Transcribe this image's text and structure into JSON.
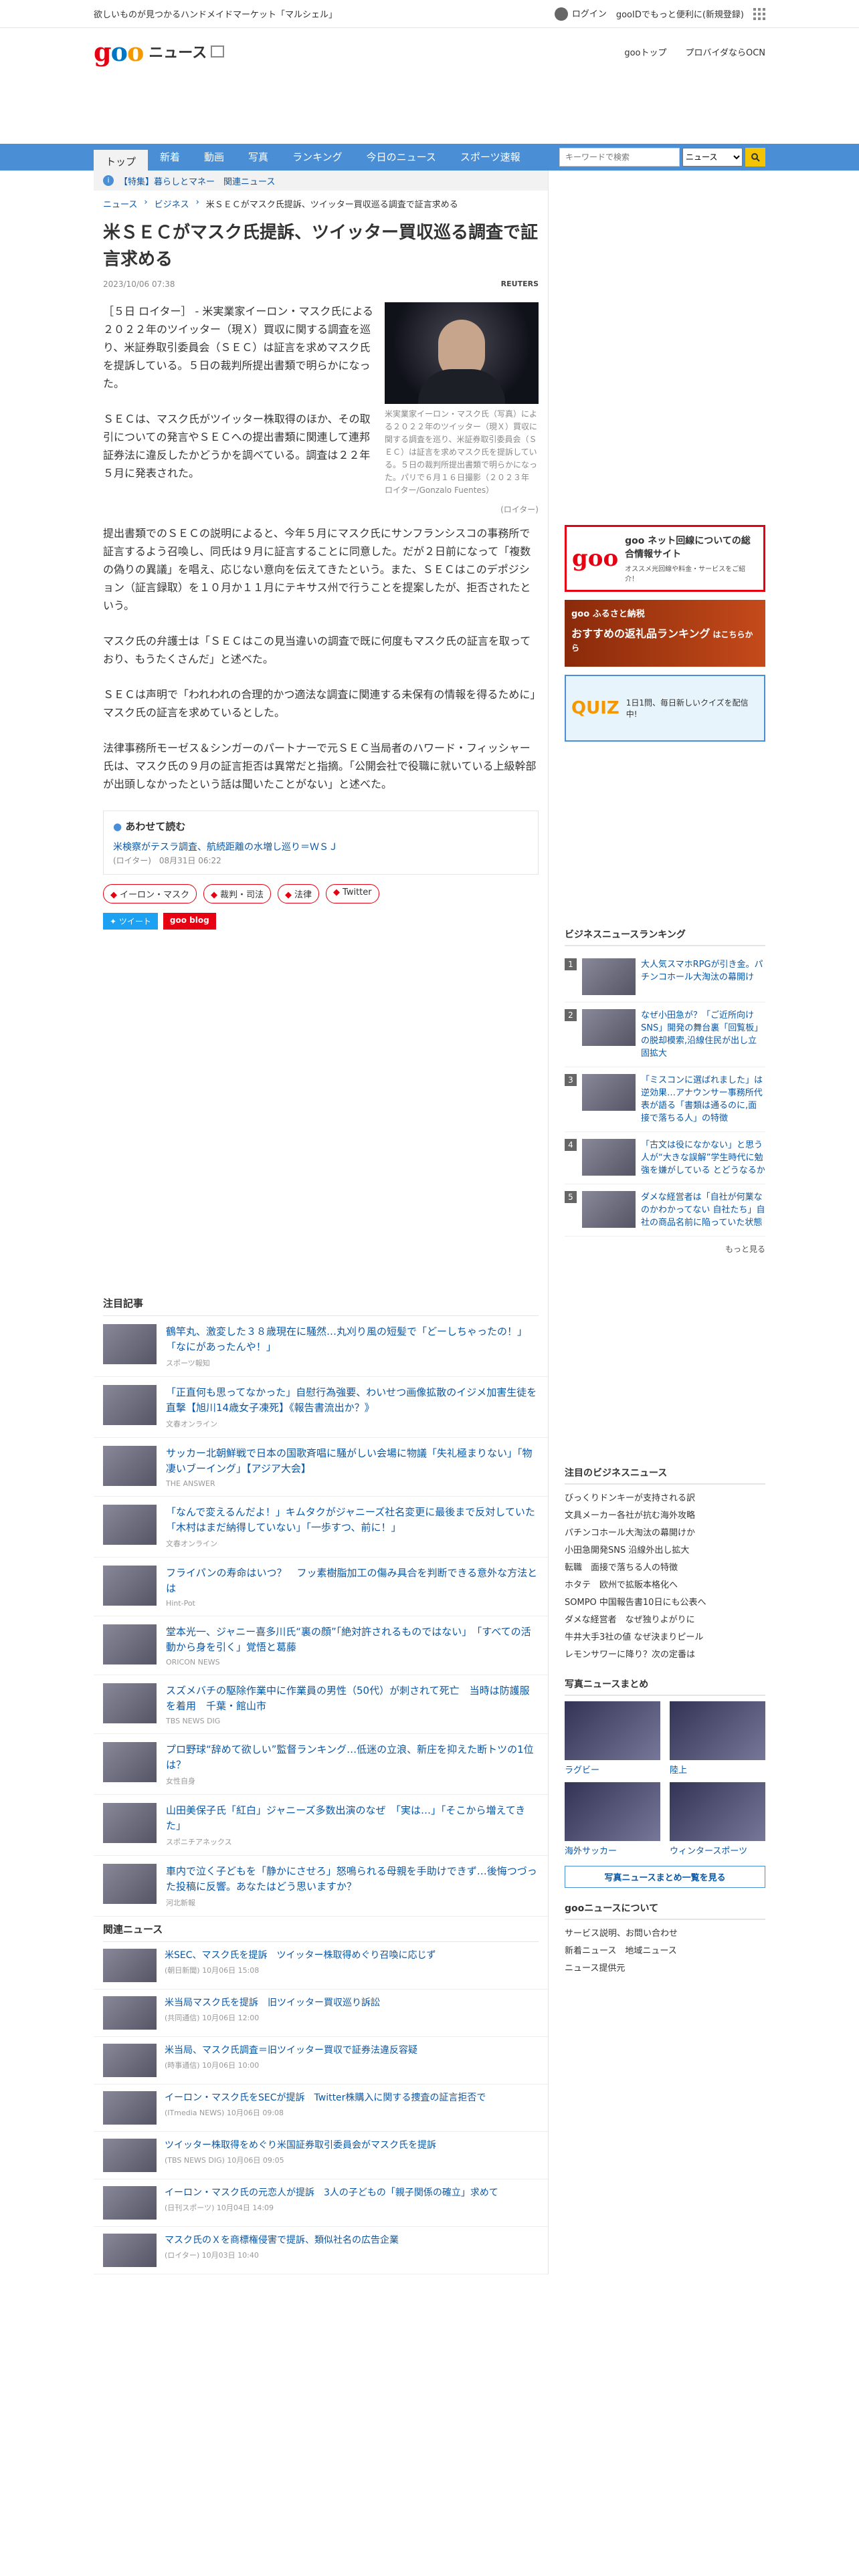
{
  "topstrip": {
    "promo": "欲しいものが見つかるハンドメイドマーケット「マルシェル」",
    "login": "ログイン",
    "signup": "gooIDでもっと便利に(新規登録)"
  },
  "header": {
    "logo_g": "g",
    "logo_o1": "o",
    "logo_o2": "o",
    "section": "ニュース",
    "link1": "gooトップ",
    "link2": "プロバイダならOCN"
  },
  "nav": {
    "tabs": [
      "トップ",
      "新着",
      "動画",
      "写真",
      "ランキング",
      "今日のニュース",
      "スポーツ速報"
    ],
    "search_placeholder": "キーワードで検索",
    "search_scope": "ニュース"
  },
  "notice": "【特集】暮らしとマネー　関連ニュース",
  "breadcrumb": [
    "ニュース",
    "ビジネス",
    "米ＳＥＣがマスク氏提訴、ツイッター買収巡る調査で証言求める"
  ],
  "article": {
    "title": "米ＳＥＣがマスク氏提訴、ツイッター買収巡る調査で証言求める",
    "date": "2023/10/06 07:38",
    "provider": "REUTERS",
    "caption": "米実業家イーロン・マスク氏（写真）による２０２２年のツイッター（現Ｘ）買収に関する調査を巡り、米証券取引委員会（ＳＥＣ）は証言を求めマスク氏を提訴している。５日の裁判所提出書類で明らかになった。パリで６月１６日撮影（２０２３年　ロイター/Gonzalo Fuentes）",
    "source": "(ロイター)",
    "paragraphs": [
      "［５日 ロイター］ - 米実業家イーロン・マスク氏による２０２２年のツイッター（現Ｘ）買収に関する調査を巡り、米証券取引委員会（ＳＥＣ）は証言を求めマスク氏を提訴している。５日の裁判所提出書類で明らかになった。",
      "ＳＥＣは、マスク氏がツイッター株取得のほか、その取引についての発言やＳＥＣへの提出書類に関連して連邦証券法に違反したかどうかを調べている。調査は２２年５月に発表された。",
      "提出書類でのＳＥＣの説明によると、今年５月にマスク氏にサンフランシスコの事務所で証言するよう召喚し、同氏は９月に証言することに同意した。だが２日前になって「複数の偽りの異議」を唱え、応じない意向を伝えてきたという。また、ＳＥＣはこのデポジション（証言録取）を１０月か１１月にテキサス州で行うことを提案したが、拒否されたという。",
      "マスク氏の弁護士は「ＳＥＣはこの見当違いの調査で既に何度もマスク氏の証言を取っており、もうたくさんだ」と述べた。",
      "ＳＥＣは声明で「われわれの合理的かつ適法な調査に関連する未保有の情報を得るために」マスク氏の証言を求めているとした。",
      "法律事務所モーゼス＆シンガーのパートナーで元ＳＥＣ当局者のハワード・フィッシャー氏は、マスク氏の９月の証言拒否は異常だと指摘。「公開会社で役職に就いている上級幹部が出頭しなかったという話は聞いたことがない」と述べた。"
    ],
    "related_heading": "あわせて読む",
    "related_link": "米検察がテスラ調査、航続距離の水増し巡り＝ＷＳＪ",
    "related_meta": "(ロイター)　08月31日 06:22",
    "tags": [
      "イーロン・マスク",
      "裁判・司法",
      "法律",
      "Twitter"
    ],
    "tweet": "ツイート",
    "blog": "goo blog"
  },
  "featured": {
    "heading": "注目記事",
    "items": [
      {
        "t": "鶴竿丸、激変した３８歳現在に騒然…丸刈り風の短髪で「どーしちゃったの！」「なにがあったんや！」",
        "s": "スポーツ報知"
      },
      {
        "t": "「正直何も思ってなかった」自慰行為強要、わいせつ画像拡散のイジメ加害生徒を直撃【旭川14歳女子凍死】《報告書流出か？》",
        "s": "文春オンライン"
      },
      {
        "t": "サッカー北朝鮮戦で日本の国歌斉唱に騒がしい会場に物議「失礼極まりない」「物凄いブーイング」【アジア大会】",
        "s": "THE ANSWER"
      },
      {
        "t": "「なんで変えるんだよ！」キムタクがジャニーズ社名変更に最後まで反対していた「木村はまだ納得していない」「一歩すつ、前に！」",
        "s": "文春オンライン"
      },
      {
        "t": "フライパンの寿命はいつ？　フッ素樹脂加工の傷み具合を判断できる意外な方法とは",
        "s": "Hint-Pot"
      },
      {
        "t": "堂本光一、ジャニー喜多川氏“裏の顔”「絶対許されるものではない」　「すべての活動から身を引く」覚悟と葛藤",
        "s": "ORICON NEWS"
      },
      {
        "t": "スズメバチの駆除作業中に作業員の男性（50代）が刺されて死亡　当時は防護服を着用　千葉・館山市",
        "s": "TBS NEWS DIG"
      },
      {
        "t": "プロ野球“辞めて欲しい”監督ランキング…低迷の立浪、新庄を抑えた断トツの1位は？",
        "s": "女性自身"
      },
      {
        "t": "山田美保子氏「紅白」ジャニーズ多数出演のなぜ　「実は…」「そこから増えてきた」",
        "s": "スポニチアネックス"
      },
      {
        "t": "車内で泣く子どもを「静かにさせろ」怒鳴られる母親を手助けできず…後悔つづった投稿に反響。あなたはどう思いますか？",
        "s": "河北新報"
      }
    ]
  },
  "relnews": {
    "heading": "関連ニュース",
    "items": [
      {
        "t": "米SEC、マスク氏を提訴　ツイッター株取得めぐり召喚に応じず",
        "s": "(朝日新聞) 10月06日 15:08"
      },
      {
        "t": "米当局マスク氏を提訴　旧ツイッター買収巡り訴訟",
        "s": "(共同通信) 10月06日 12:00"
      },
      {
        "t": "米当局、マスク氏調査＝旧ツイッター買収で証券法違反容疑",
        "s": "(時事通信) 10月06日 10:00"
      },
      {
        "t": "イーロン・マスク氏をSECが提訴　Twitter株購入に関する捜査の証言拒否で",
        "s": "(ITmedia NEWS) 10月06日 09:08"
      },
      {
        "t": "ツイッター株取得をめぐり米国証券取引委員会がマスク氏を提訴",
        "s": "(TBS NEWS DIG) 10月06日 09:05"
      },
      {
        "t": "イーロン・マスク氏の元恋人が提訴　3人の子どもの「親子関係の確立」求めて",
        "s": "(日刊スポーツ) 10月04日 14:09"
      },
      {
        "t": "マスク氏のＸを商標権侵害で提訴、類似社名の広告企業",
        "s": "(ロイター) 10月03日 10:40"
      }
    ]
  },
  "side": {
    "banner1_title": "goo ネット回線についての総合情報サイト",
    "banner1_sub": "オススメ光回線や料金・サービスをご紹介！",
    "banner2_title": "goo ふるさと納税",
    "banner2_sub": "おすすめの返礼品ランキング",
    "banner2_cta": "はこちらから",
    "banner3_title": "QUIZ",
    "banner3_sub": "1日1問、毎日新しいクイズを配信中!",
    "ranking_heading": "ビジネスニュースランキング",
    "ranking": [
      "大人気スマホRPGが引き金。パチンコホール大淘汰の幕開け",
      "なぜ小田急が？「ご近所向けSNS」開発の舞台裏「回覧板」の脱却模索,沿線住民が出し立固拡大",
      "「ミスコンに選ばれました」は逆効果…アナウンサー事務所代表が語る「書類は通るのに,面接で落ちる人」の特徴",
      "「古文は役になかない」と思う人が“大きな誤解”学生時代に勉強を嫌がしている とどうなるか",
      "ダメな経営者は「自社が何業なのかわかってない 自社たち」自社の商品名前に陥っていた状態"
    ],
    "more": "もっと見る",
    "kw_heading": "注目のビジネスニュース",
    "keywords": [
      "びっくりドンキーが支持される訳",
      "文具メーカー各社が抗む海外攻略",
      "パチンコホール大淘汰の幕開けか",
      "小田急開発SNS 沿線外出し拡大",
      "転職　面接で落ちる人の特徴",
      "ホタテ　欧州で拡販本格化へ",
      "SOMPO 中国報告書10日にも公表へ",
      "ダメな経営者　なぜ独りよがりに",
      "牛井大手3社の値 なぜ決まりピール",
      "レモンサワーに降り？次の定番は"
    ],
    "photo_heading": "写真ニュースまとめ",
    "photos": [
      "ラグビー",
      "陸上",
      "海外サッカー",
      "ウィンタースポーツ"
    ],
    "photo_btn": "写真ニュースまとめ一覧を見る",
    "about_heading": "gooニュースについて",
    "about": [
      "サービス説明、お問い合わせ",
      "新着ニュース　地域ニュース",
      "ニュース提供元"
    ]
  }
}
